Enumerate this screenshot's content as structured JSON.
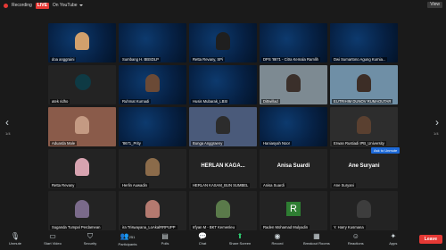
{
  "topbar": {
    "recording": "Recording",
    "live": "LIVE",
    "youtube": "On YouTube",
    "view": "View"
  },
  "nav": {
    "left_page": "1/4",
    "right_page": "1/4"
  },
  "participants": [
    {
      "name": "doa anggraini"
    },
    {
      "name": "Sumbang H. BBSDLP"
    },
    {
      "name": "Retta Revany, SPi"
    },
    {
      "name": "DPS '8671 - Citra Kemala Ramlih"
    },
    {
      "name": "Dwi Sumartono Agung Kurnia..."
    },
    {
      "name": "atek ridho"
    },
    {
      "name": "Ruhmat Kurnadi"
    },
    {
      "name": "Husis Mubarak_LBSI"
    },
    {
      "name": "Dittwillad"
    },
    {
      "name": "EUTRIHIM DUNOV RUMAOUTAR"
    },
    {
      "name": "Aduarda Male"
    },
    {
      "name": "'8671_Prity"
    },
    {
      "name": "Bunga Anggraeny"
    },
    {
      "name": "Haniasyah Noor"
    },
    {
      "name": "Erwan Rustiadi IPB_University"
    },
    {
      "name": "Retta Revany"
    },
    {
      "name": "Herlin Auwadin"
    },
    {
      "name": "HERLAN KASAM_BUN SUMBEL",
      "display": "HERLAN KAGA..."
    },
    {
      "name": "Anisa Suardi",
      "display": "Anisa Suardi"
    },
    {
      "name": "Ane Suryani",
      "display": "Ane Suryani"
    },
    {
      "name": "Suganda Tumpal Perdamean"
    },
    {
      "name": "ira Triswayana_LoAkalRRPUPP"
    },
    {
      "name": "Irfyan M - BKT Kemenleu"
    },
    {
      "name": "Raden Mohamad Mulyadin"
    },
    {
      "name": "Y. Harry Kusmana"
    }
  ],
  "ask_button": "Ask to Unmute",
  "r_letter": "R",
  "toolbar": {
    "unmute": "Unmute",
    "start_video": "Start Video",
    "security": "Security",
    "participants": "Participants",
    "participants_count": "251",
    "polls": "Polls",
    "chat": "Chat",
    "share_screen": "Share Screen",
    "record": "Record",
    "breakout": "Breakout Rooms",
    "reactions": "Reactions",
    "apps": "Apps",
    "leave": "Leave"
  }
}
